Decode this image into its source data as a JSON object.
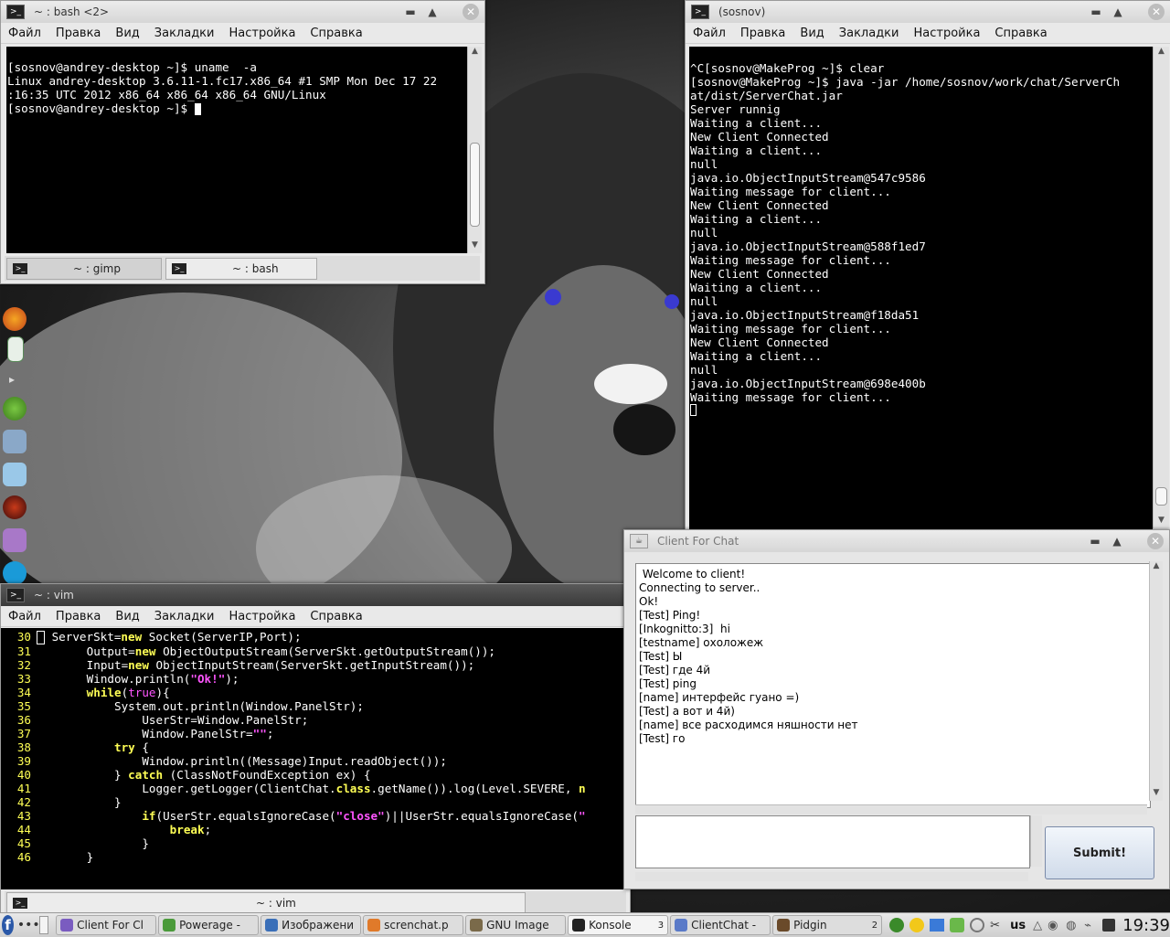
{
  "menu": [
    "Файл",
    "Правка",
    "Вид",
    "Закладки",
    "Настройка",
    "Справка"
  ],
  "bash_window": {
    "title": "~ : bash <2>",
    "lines": [
      "[sosnov@andrey-desktop ~]$ uname  -a",
      "Linux andrey-desktop 3.6.11-1.fc17.x86_64 #1 SMP Mon Dec 17 22",
      ":16:35 UTC 2012 x86_64 x86_64 x86_64 GNU/Linux",
      "[sosnov@andrey-desktop ~]$ "
    ],
    "tabs": [
      "~ : gimp",
      "~ : bash"
    ]
  },
  "server_window": {
    "title": "(sosnov)",
    "lines": [
      "^C[sosnov@MakeProg ~]$ clear",
      "[sosnov@MakeProg ~]$ java -jar /home/sosnov/work/chat/ServerCh",
      "at/dist/ServerChat.jar",
      "Server runnig",
      "Waiting a client...",
      "New Client Connected",
      "Waiting a client...",
      "null",
      "java.io.ObjectInputStream@547c9586",
      "Waiting message for client...",
      "New Client Connected",
      "Waiting a client...",
      "null",
      "java.io.ObjectInputStream@588f1ed7",
      "Waiting message for client...",
      "New Client Connected",
      "Waiting a client...",
      "null",
      "java.io.ObjectInputStream@f18da51",
      "Waiting message for client...",
      "New Client Connected",
      "Waiting a client...",
      "null",
      "java.io.ObjectInputStream@698e400b",
      "Waiting message for client..."
    ]
  },
  "vim_window": {
    "title": "~ : vim",
    "tab": "~ : vim",
    "lines": [
      {
        "n": "30",
        "code": "        ServerSkt=<kw>new</kw> Socket(ServerIP,Port);"
      },
      {
        "n": "31",
        "code": "        Output=<kw>new</kw> ObjectOutputStream(ServerSkt.getOutputStream());"
      },
      {
        "n": "32",
        "code": "        Input=<kw>new</kw> ObjectInputStream(ServerSkt.getInputStream());"
      },
      {
        "n": "33",
        "code": "        Window.println(<str>\"Ok!\"</str>);"
      },
      {
        "n": "34",
        "code": "        <kw>while</kw>(<kt>true</kt>){"
      },
      {
        "n": "35",
        "code": "            System.out.println(Window.PanelStr);"
      },
      {
        "n": "36",
        "code": "                UserStr=Window.PanelStr;"
      },
      {
        "n": "37",
        "code": "                Window.PanelStr=<str>\"\"</str>;"
      },
      {
        "n": "38",
        "code": "            <kw>try</kw> {"
      },
      {
        "n": "39",
        "code": "                Window.println((Message)Input.readObject());"
      },
      {
        "n": "40",
        "code": "            } <kw>catch</kw> (ClassNotFoundException ex) {"
      },
      {
        "n": "41",
        "code": "                Logger.getLogger(ClientChat.<kw>class</kw>.getName()).log(Level.SEVERE, <kw>n</kw>"
      },
      {
        "n": "42",
        "code": "            }"
      },
      {
        "n": "43",
        "code": "                <kw>if</kw>(UserStr.equalsIgnoreCase(<str>\"close\"</str>)||UserStr.equalsIgnoreCase(<str>\"</str>"
      },
      {
        "n": "44",
        "code": "                    <kw>break</kw>;"
      },
      {
        "n": "45",
        "code": "                }"
      },
      {
        "n": "46",
        "code": "        }"
      }
    ]
  },
  "chat_window": {
    "title": "Client For Chat",
    "messages": [
      " Welcome to client!",
      "Connecting to server..",
      "Ok!",
      "[Test] Ping!",
      "[Inkognitto:3]  hi",
      "[testname] охоложеж",
      "[Test] Ы",
      "[Test] где 4й",
      "[Test] ping",
      "[name] интерфейс гуано =)",
      "[Test] а вот и 4й)",
      "[name] все расходимся няшности нет",
      "[Test] го"
    ],
    "input_value": "",
    "submit_label": "Submit!"
  },
  "taskbar": {
    "tasks": [
      {
        "label": "Client For Cl",
        "icon_color": "#7a5cc0"
      },
      {
        "label": "Powerage -",
        "icon_color": "#4a9a3a"
      },
      {
        "label": "Изображени",
        "icon_color": "#3a6fb8"
      },
      {
        "label": "scrеnchat.p",
        "icon_color": "#e07a2a"
      },
      {
        "label": "GNU Image",
        "icon_color": "#7a6a4a"
      },
      {
        "label": "Konsole",
        "icon_color": "#222222",
        "count": "3",
        "active": true
      },
      {
        "label": "ClientChat -",
        "icon_color": "#5a7ac8"
      },
      {
        "label": "Pidgin",
        "icon_color": "#6a4a2a",
        "count": "2"
      }
    ],
    "keyboard_layout": "us",
    "clock": "19:39"
  }
}
